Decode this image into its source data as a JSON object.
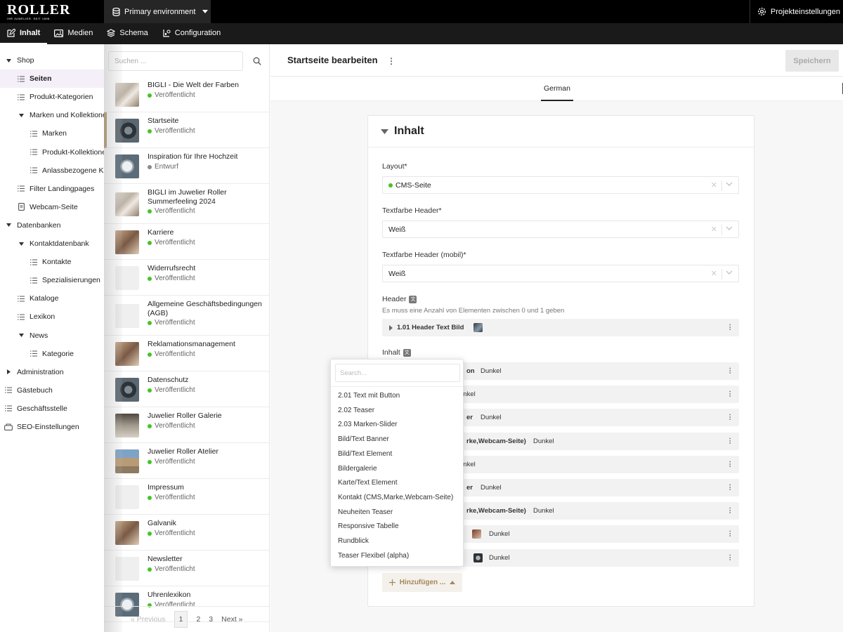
{
  "topbar": {
    "logo": {
      "name": "ROLLER",
      "tagline": "IHR JUWELIER. SEIT 1898."
    },
    "environment": "Primary environment",
    "project_label": "Projekteinstellungen"
  },
  "nav": {
    "tabs": [
      {
        "label": "Inhalt",
        "icon": "edit-icon",
        "active": true
      },
      {
        "label": "Medien",
        "icon": "image-icon"
      },
      {
        "label": "Schema",
        "icon": "layers-icon"
      },
      {
        "label": "Configuration",
        "icon": "config-icon"
      }
    ]
  },
  "tree": {
    "items": [
      {
        "label": "Shop",
        "type": "expanded",
        "level": 0
      },
      {
        "label": "Seiten",
        "type": "list",
        "level": 1,
        "selected": true
      },
      {
        "label": "Produkt-Kategorien",
        "type": "list",
        "level": 1
      },
      {
        "label": "Marken und Kollektionen",
        "type": "expanded",
        "level": 1
      },
      {
        "label": "Marken",
        "type": "list",
        "level": 2
      },
      {
        "label": "Produkt-Kollektionen",
        "type": "list",
        "level": 2
      },
      {
        "label": "Anlassbezogene Kollektionen",
        "type": "list",
        "level": 2
      },
      {
        "label": "Filter Landingpages",
        "type": "list",
        "level": 1
      },
      {
        "label": "Webcam-Seite",
        "type": "doc",
        "level": 1
      },
      {
        "label": "Datenbanken",
        "type": "expanded",
        "level": 0
      },
      {
        "label": "Kontaktdatenbank",
        "type": "expanded",
        "level": 1
      },
      {
        "label": "Kontakte",
        "type": "list",
        "level": 2
      },
      {
        "label": "Spezialisierungen",
        "type": "list",
        "level": 2
      },
      {
        "label": "Kataloge",
        "type": "list",
        "level": 1
      },
      {
        "label": "Lexikon",
        "type": "list",
        "level": 1
      },
      {
        "label": "News",
        "type": "expanded",
        "level": 1
      },
      {
        "label": "Kategorie",
        "type": "list",
        "level": 2
      },
      {
        "label": "Administration",
        "type": "collapsed",
        "level": 0
      },
      {
        "label": "Gästebuch",
        "type": "list",
        "level": 0
      },
      {
        "label": "Geschäftsstelle",
        "type": "list",
        "level": 0
      },
      {
        "label": "SEO-Einstellungen",
        "type": "doc2",
        "level": 0
      }
    ]
  },
  "list": {
    "search_placeholder": "Suchen ...",
    "pages": [
      {
        "title": "BIGLI - Die Welt der Farben",
        "status": "Veröffentlicht",
        "state": "published",
        "thumb": "photo"
      },
      {
        "title": "Startseite",
        "status": "Veröffentlicht",
        "state": "published",
        "thumb": "watch",
        "active": true
      },
      {
        "title": "Inspiration für Ihre Hochzeit",
        "status": "Entwurf",
        "state": "draft",
        "thumb": "ring"
      },
      {
        "title": "BIGLI im Juwelier Roller Summerfeeling 2024",
        "status": "Veröffentlicht",
        "state": "published",
        "thumb": "photo"
      },
      {
        "title": "Karriere",
        "status": "Veröffentlicht",
        "state": "published",
        "thumb": "warm"
      },
      {
        "title": "Widerrufsrecht",
        "status": "Veröffentlicht",
        "state": "published",
        "thumb": "empty"
      },
      {
        "title": "Allgemeine Geschäftsbedingungen (AGB)",
        "status": "Veröffentlicht",
        "state": "published",
        "thumb": "empty"
      },
      {
        "title": "Reklamationsmanagement",
        "status": "Veröffentlicht",
        "state": "published",
        "thumb": "warm"
      },
      {
        "title": "Datenschutz",
        "status": "Veröffentlicht",
        "state": "published",
        "thumb": "watch"
      },
      {
        "title": "Juwelier Roller Galerie",
        "status": "Veröffentlicht",
        "state": "published",
        "thumb": "store"
      },
      {
        "title": "Juwelier Roller Atelier",
        "status": "Veröffentlicht",
        "state": "published",
        "thumb": "building"
      },
      {
        "title": "Impressum",
        "status": "Veröffentlicht",
        "state": "published",
        "thumb": "empty"
      },
      {
        "title": "Galvanik",
        "status": "Veröffentlicht",
        "state": "published",
        "thumb": "warm"
      },
      {
        "title": "Newsletter",
        "status": "Veröffentlicht",
        "state": "published",
        "thumb": "empty"
      },
      {
        "title": "Uhrenlexikon",
        "status": "Veröffentlicht",
        "state": "published",
        "thumb": "ring"
      }
    ],
    "pager": {
      "prev": "« Previous",
      "pages": [
        "1",
        "2",
        "3"
      ],
      "current": "1",
      "next": "Next »"
    }
  },
  "editor": {
    "title": "Startseite bearbeiten",
    "save_label": "Speichern",
    "language_tab": "German",
    "section_title": "Inhalt",
    "layout_label": "Layout*",
    "layout_value": "CMS-Seite",
    "textfarbe_label": "Textfarbe Header*",
    "textfarbe_value": "Weiß",
    "textfarbe_mobil_label": "Textfarbe Header (mobil)*",
    "textfarbe_mobil_value": "Weiß",
    "header_label": "Header",
    "header_hint": "Es muss eine Anzahl von Elementen zwischen 0 und 1 geben",
    "header_block": "1.01 Header Text Bild",
    "inhalt_label": "Inhalt",
    "inhalt_rows": [
      {
        "partial": "on",
        "value": "Dunkel"
      },
      {
        "partial": "",
        "value": "unkel"
      },
      {
        "partial": "er",
        "value": "Dunkel"
      },
      {
        "partial": "rke,Webcam-Seite)",
        "value": "Dunkel"
      },
      {
        "partial": "",
        "value": "unkel"
      },
      {
        "partial": "er",
        "value": "Dunkel"
      },
      {
        "partial": "rke,Webcam-Seite)",
        "value": "Dunkel"
      },
      {
        "partial": "",
        "value": "Dunkel",
        "thumb": true
      },
      {
        "partial": "",
        "value": "Dunkel",
        "thumb": true
      }
    ],
    "add_label": "Hinzufügen ..."
  },
  "dropdown": {
    "search_placeholder": "Search...",
    "options": [
      "2.01 Text mit Button",
      "2.02 Teaser",
      "2.03 Marken-Slider",
      "Bild/Text Banner",
      "Bild/Text Element",
      "Bildergalerie",
      "Karte/Text Element",
      "Kontakt (CMS,Marke,Webcam-Seite)",
      "Neuheiten Teaser",
      "Responsive Tabelle",
      "Rundblick",
      "Teaser Flexibel (alpha)"
    ]
  },
  "colors": {
    "published": "#44c424",
    "draft": "#8a8a8a",
    "accent": "#a6865a",
    "active_border": "#b79b70"
  }
}
